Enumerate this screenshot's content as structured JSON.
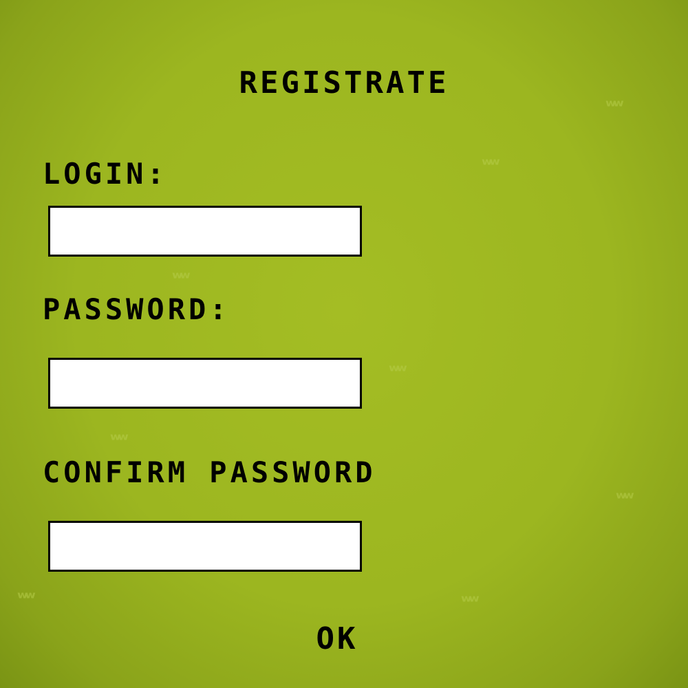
{
  "form": {
    "title": "REGISTRATE",
    "login_label": "LOGIN:",
    "login_value": "",
    "password_label": "PASSWORD:",
    "password_value": "",
    "confirm_label": "CONFIRM PASSWORD",
    "confirm_value": "",
    "ok_label": "OK"
  },
  "colors": {
    "background": "#9cb620",
    "text": "#000000",
    "field": "#ffffff"
  }
}
